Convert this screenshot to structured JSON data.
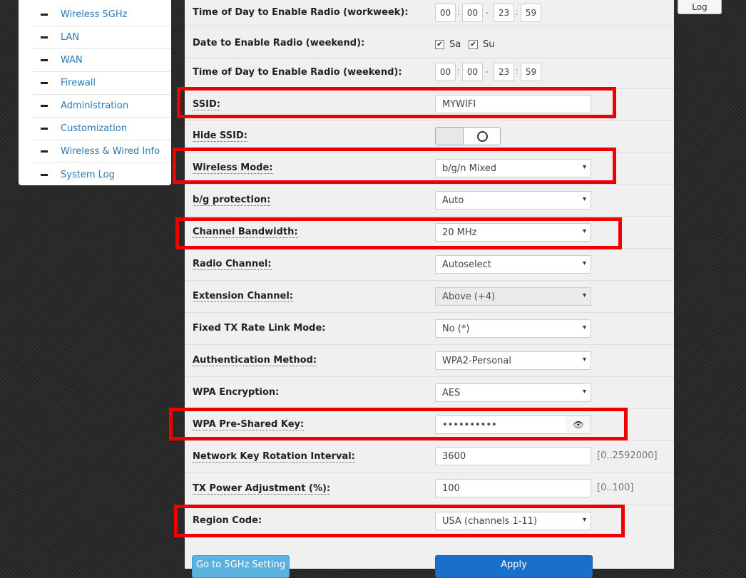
{
  "sidebar": {
    "items": [
      {
        "label": "Wireless 5GHz"
      },
      {
        "label": "LAN"
      },
      {
        "label": "WAN"
      },
      {
        "label": "Firewall"
      },
      {
        "label": "Administration"
      },
      {
        "label": "Customization"
      },
      {
        "label": "Wireless & Wired Info"
      },
      {
        "label": "System Log"
      }
    ]
  },
  "header": {
    "log_button": "Log"
  },
  "form": {
    "time_workweek": {
      "label": "Time of Day to Enable Radio (workweek):",
      "start_h": "00",
      "start_m": "00",
      "end_h": "23",
      "end_m": "59"
    },
    "date_weekend": {
      "label": "Date to Enable Radio (weekend):",
      "sa": "Sa",
      "su": "Su"
    },
    "time_weekend": {
      "label": "Time of Day to Enable Radio (weekend):",
      "start_h": "00",
      "start_m": "00",
      "end_h": "23",
      "end_m": "59"
    },
    "ssid": {
      "label": "SSID:",
      "value": "MYWIFI"
    },
    "hide_ssid": {
      "label": "Hide SSID:"
    },
    "wireless_mode": {
      "label": "Wireless Mode:",
      "value": "b/g/n Mixed"
    },
    "bg_protection": {
      "label": "b/g protection:",
      "value": "Auto"
    },
    "channel_bandwidth": {
      "label": "Channel Bandwidth:",
      "value": "20 MHz"
    },
    "radio_channel": {
      "label": "Radio Channel:",
      "value": "Autoselect"
    },
    "extension_channel": {
      "label": "Extension Channel:",
      "value": "Above (+4)"
    },
    "fixed_tx": {
      "label": "Fixed TX Rate Link Mode:",
      "value": "No (*)"
    },
    "auth_method": {
      "label": "Authentication Method:",
      "value": "WPA2-Personal"
    },
    "wpa_encryption": {
      "label": "WPA Encryption:",
      "value": "AES"
    },
    "psk": {
      "label": "WPA Pre-Shared Key:",
      "value": "••••••••••"
    },
    "key_rotation": {
      "label": "Network Key Rotation Interval:",
      "value": "3600",
      "hint": "[0..2592000]"
    },
    "tx_power": {
      "label": "TX Power Adjustment (%):",
      "value": "100",
      "hint": "[0..100]"
    },
    "region_code": {
      "label": "Region Code:",
      "value": "USA (channels 1-11)"
    }
  },
  "buttons": {
    "goto_5ghz": "Go to 5GHz Setting",
    "apply": "Apply"
  },
  "icons": {
    "caret": "▾",
    "check": "✔",
    "time_colon": ":",
    "time_dash": "-",
    "eye": "👁"
  },
  "colors": {
    "highlight": "#ee0000",
    "apply": "#1a6fcb",
    "goto": "#5ab3de",
    "link": "#2a7ab8"
  }
}
